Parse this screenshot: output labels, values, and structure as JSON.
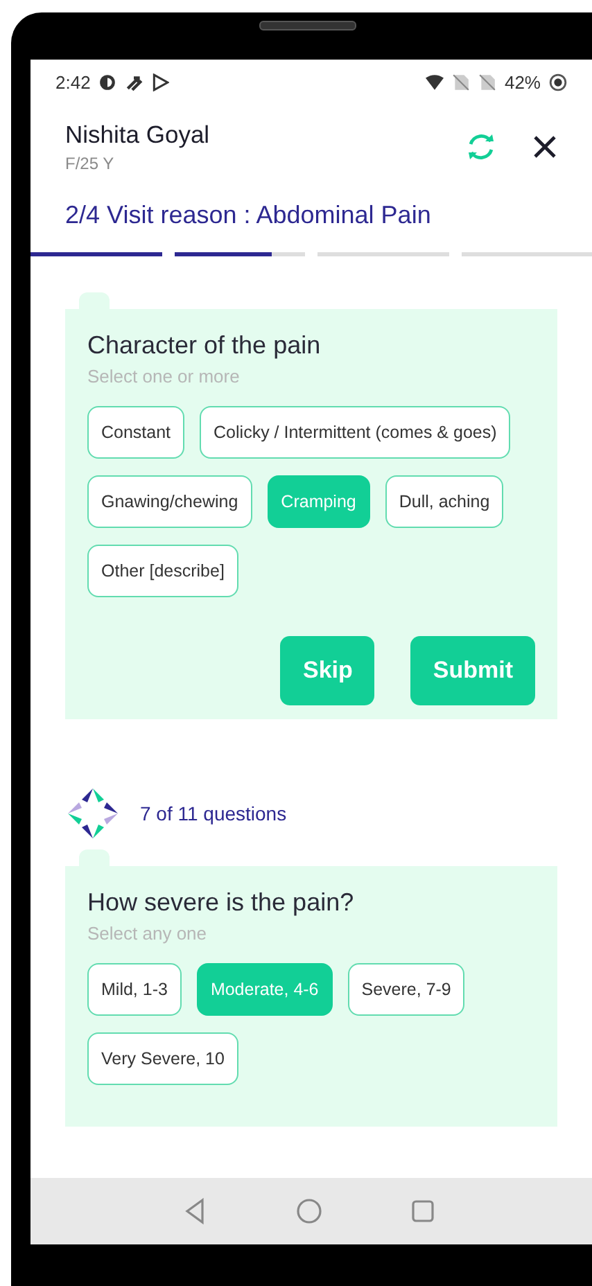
{
  "status_bar": {
    "time": "2:42",
    "battery": "42%"
  },
  "header": {
    "name": "Nishita Goyal",
    "details": "F/25 Y",
    "visit_reason": "2/4 Visit reason : Abdominal Pain"
  },
  "progress": [
    {
      "level": 1
    },
    {
      "level": 0.75
    },
    {
      "level": 0
    },
    {
      "level": 0
    }
  ],
  "questions": [
    {
      "title": "Character of the pain",
      "hint": "Select one or more",
      "options": [
        {
          "label": "Constant",
          "selected": false
        },
        {
          "label": "Colicky / Intermittent (comes & goes)",
          "selected": false
        },
        {
          "label": "Gnawing/chewing",
          "selected": false
        },
        {
          "label": "Cramping",
          "selected": true
        },
        {
          "label": "Dull, aching",
          "selected": false
        },
        {
          "label": "Other [describe]",
          "selected": false
        }
      ],
      "actions": [
        "Skip",
        "Submit"
      ]
    },
    {
      "counter": "7 of 11 questions",
      "title": "How severe is the pain?",
      "hint": "Select any one",
      "options": [
        {
          "label": "Mild, 1-3",
          "selected": false
        },
        {
          "label": "Moderate, 4-6",
          "selected": true
        },
        {
          "label": "Severe, 7-9",
          "selected": false
        },
        {
          "label": "Very Severe, 10",
          "selected": false
        }
      ]
    }
  ]
}
